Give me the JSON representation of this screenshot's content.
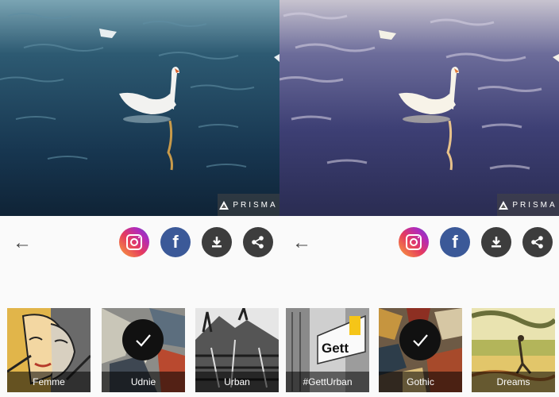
{
  "screens": [
    {
      "watermark": "PRISMA",
      "toolbar": {
        "back": "←",
        "instagram": "instagram-icon",
        "facebook": "f",
        "download": "download-icon",
        "share": "share-icon"
      },
      "filters": [
        {
          "label": "Femme",
          "selected": false
        },
        {
          "label": "Udnie",
          "selected": true
        },
        {
          "label": "Urban",
          "selected": false
        }
      ]
    },
    {
      "watermark": "PRISMA",
      "toolbar": {
        "back": "←",
        "instagram": "instagram-icon",
        "facebook": "f",
        "download": "download-icon",
        "share": "share-icon"
      },
      "filters": [
        {
          "label": "#GettUrban",
          "selected": false,
          "badge": "Gett"
        },
        {
          "label": "Gothic",
          "selected": true
        },
        {
          "label": "Dreams",
          "selected": false
        }
      ]
    }
  ],
  "colors": {
    "water_left": "#1d3d57",
    "water_right": "#3c3f72",
    "instagram_gradient": [
      "#f9a23b",
      "#e53b5e",
      "#b32ab8",
      "#5a4fcf"
    ],
    "facebook": "#3b5998",
    "dark_button": "#3d3d3d"
  }
}
